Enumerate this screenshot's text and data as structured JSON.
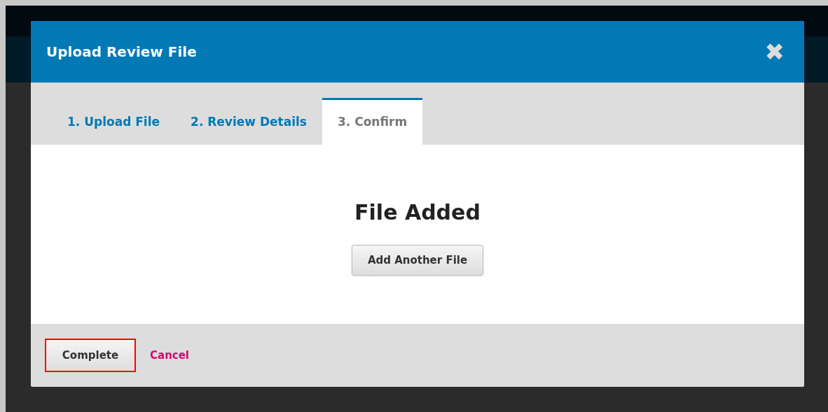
{
  "dialog": {
    "title": "Upload Review File",
    "close_icon": "✖"
  },
  "tabs": [
    {
      "label": "1. Upload File",
      "selected": false
    },
    {
      "label": "2. Review Details",
      "selected": false
    },
    {
      "label": "3. Confirm",
      "selected": true
    }
  ],
  "body": {
    "heading": "File Added",
    "button": "Add Another File"
  },
  "footer": {
    "complete": {
      "label": "Complete",
      "highlighted": true
    },
    "cancel": "Cancel"
  }
}
